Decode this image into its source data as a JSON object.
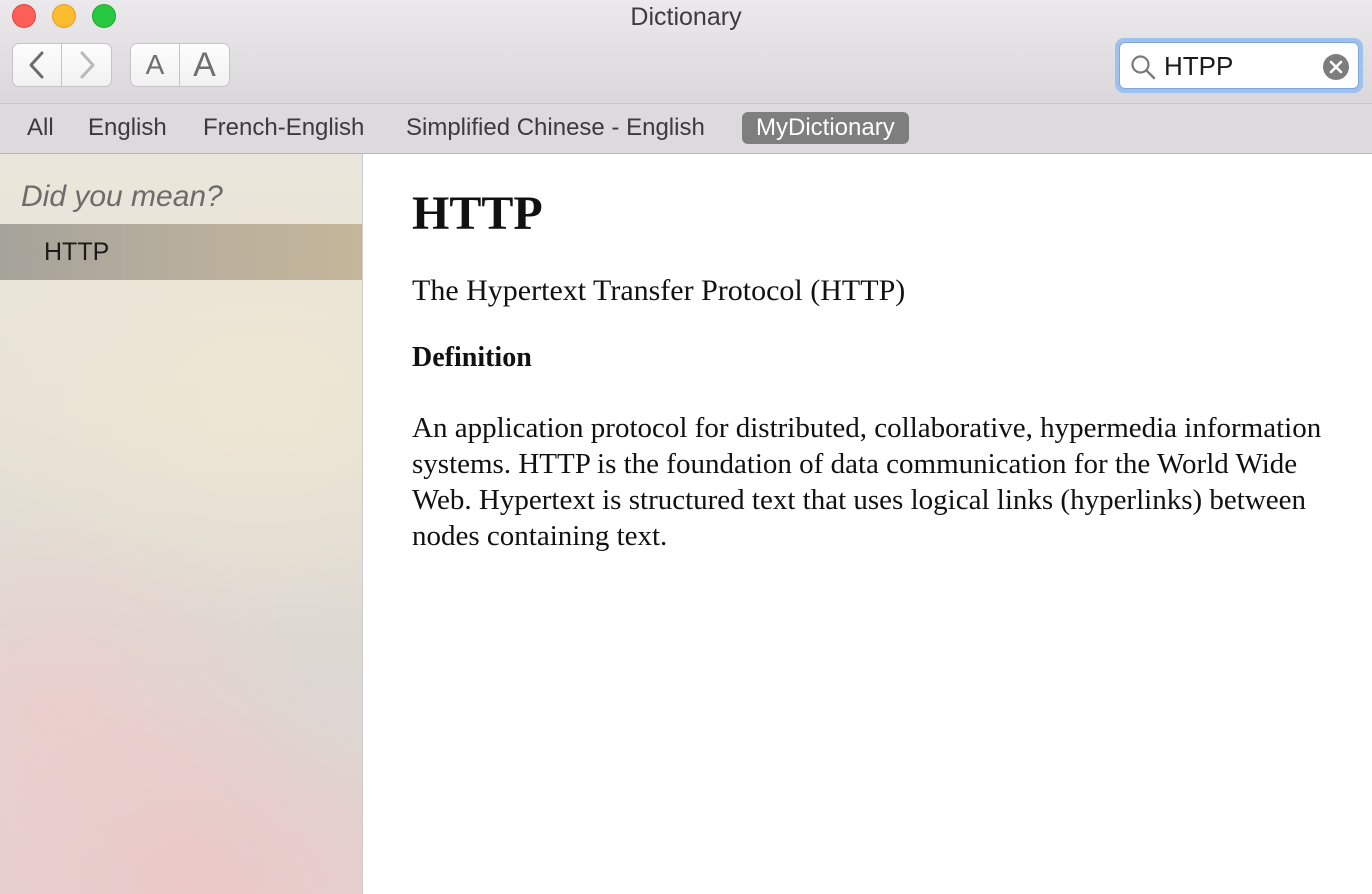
{
  "window": {
    "title": "Dictionary"
  },
  "toolbar": {
    "back_icon": "chevron-left-icon",
    "forward_icon": "chevron-right-icon",
    "font_smaller_label": "A",
    "font_larger_label": "A"
  },
  "search": {
    "value": "HTPP",
    "icon": "magnifier-icon",
    "clear_icon": "clear-circle-x-icon"
  },
  "scopes": [
    {
      "label": "All",
      "active": false
    },
    {
      "label": "English",
      "active": false
    },
    {
      "label": "French-English",
      "active": false
    },
    {
      "label": "Simplified Chinese - English",
      "active": false
    },
    {
      "label": "MyDictionary",
      "active": true
    }
  ],
  "sidebar": {
    "heading": "Did you mean?",
    "suggestions": [
      "HTTP"
    ]
  },
  "entry": {
    "headword": "HTTP",
    "subtitle": "The Hypertext Transfer Protocol (HTTP)",
    "section_title": "Definition",
    "definition": "An application protocol for distributed, collaborative, hypermedia information systems. HTTP is the foundation of data communication for the World Wide Web. Hypertext is structured text that uses logical links (hyperlinks) between nodes containing text."
  },
  "colors": {
    "close": "#fc5f57",
    "minimize": "#fdbc2e",
    "zoom": "#28c840",
    "active_scope": "#7e7e7e",
    "search_focus_ring": "#9fc1ef"
  }
}
